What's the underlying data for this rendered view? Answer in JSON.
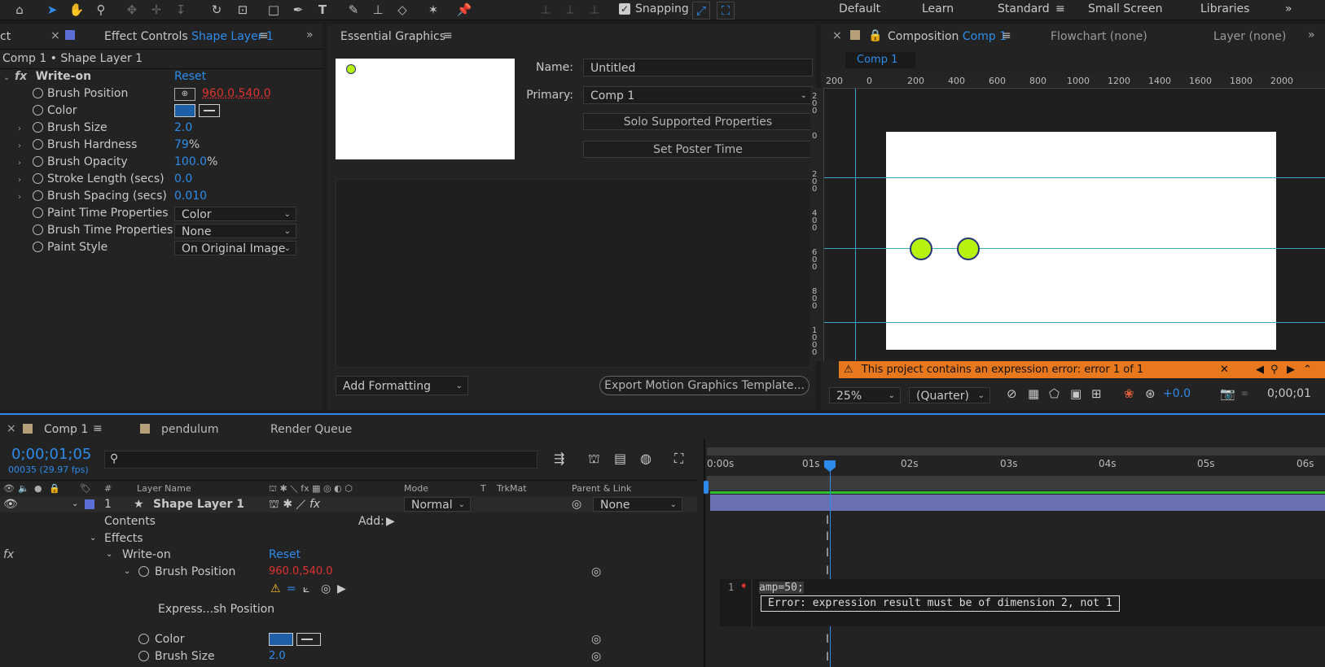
{
  "workspaces": {
    "default": "Default",
    "learn": "Learn",
    "standard": "Standard",
    "small_screen": "Small Screen",
    "libraries": "Libraries"
  },
  "toolbar": {
    "snapping": "Snapping"
  },
  "effect_controls": {
    "tab_left": "ct",
    "title": "Effect Controls",
    "layer": "Shape Layer 1",
    "breadcrumb": "Comp 1 • Shape Layer 1",
    "effect_name": "Write-on",
    "reset": "Reset",
    "props": [
      {
        "name": "Brush Position",
        "value": "960.0,540.0"
      },
      {
        "name": "Color"
      },
      {
        "name": "Brush Size",
        "value": "2.0"
      },
      {
        "name": "Brush Hardness",
        "value": "79",
        "unit": "%"
      },
      {
        "name": "Brush Opacity",
        "value": "100.0",
        "unit": "%"
      },
      {
        "name": "Stroke Length (secs)",
        "value": "0.0"
      },
      {
        "name": "Brush Spacing (secs)",
        "value": "0.010"
      },
      {
        "name": "Paint Time Properties",
        "value": "Color"
      },
      {
        "name": "Brush Time Properties",
        "value": "None"
      },
      {
        "name": "Paint Style",
        "value": "On Original Image"
      }
    ]
  },
  "essential_graphics": {
    "title": "Essential Graphics",
    "name_label": "Name:",
    "name_value": "Untitled",
    "primary_label": "Primary:",
    "primary_value": "Comp 1",
    "solo_button": "Solo Supported Properties",
    "poster_button": "Set Poster Time",
    "add_formatting": "Add Formatting",
    "export_button": "Export Motion Graphics Template..."
  },
  "composition": {
    "title": "Composition",
    "comp": "Comp 1",
    "flowchart": "Flowchart (none)",
    "layer": "Layer (none)",
    "comp_tab": "Comp 1",
    "ruler_h": [
      "200",
      "0",
      "200",
      "400",
      "600",
      "800",
      "1000",
      "1200",
      "1400",
      "1600",
      "1800",
      "2000"
    ],
    "ruler_v": [
      "2 0 0",
      "0",
      "2 0 0",
      "4 0 0",
      "6 0 0",
      "8 0 0",
      "1 0 0 0"
    ],
    "error_text": "This project contains an expression error: error 1 of 1",
    "zoom": "25%",
    "resolution": "(Quarter)",
    "exposure": "+0.0",
    "timecode": "0;00;01"
  },
  "timeline": {
    "tabs": [
      "Comp 1",
      "pendulum",
      "Render Queue"
    ],
    "timecode": "0;00;01;05",
    "frame": "00035 (29.97 fps)",
    "columns": {
      "num": "#",
      "layer_name": "Layer Name",
      "mode": "Mode",
      "t": "T",
      "trkmat": "TrkMat",
      "parent": "Parent & Link"
    },
    "layer": {
      "num": "1",
      "name": "Shape Layer 1",
      "mode": "Normal",
      "parent": "None"
    },
    "contents": "Contents",
    "add": "Add:",
    "effects": "Effects",
    "write_on": "Write-on",
    "reset": "Reset",
    "brush_position": "Brush Position",
    "brush_position_value": "960.0,540.0",
    "expression_label": "Express...sh Position",
    "color": "Color",
    "brush_size": "Brush Size",
    "brush_size_value": "2.0",
    "ticks": [
      "0:00s",
      "01s",
      "02s",
      "03s",
      "04s",
      "05s",
      "06s"
    ],
    "expr_line": "1",
    "expr_code": "amp=50;",
    "expr_error": "Error:  expression result must be of dimension 2, not 1"
  }
}
